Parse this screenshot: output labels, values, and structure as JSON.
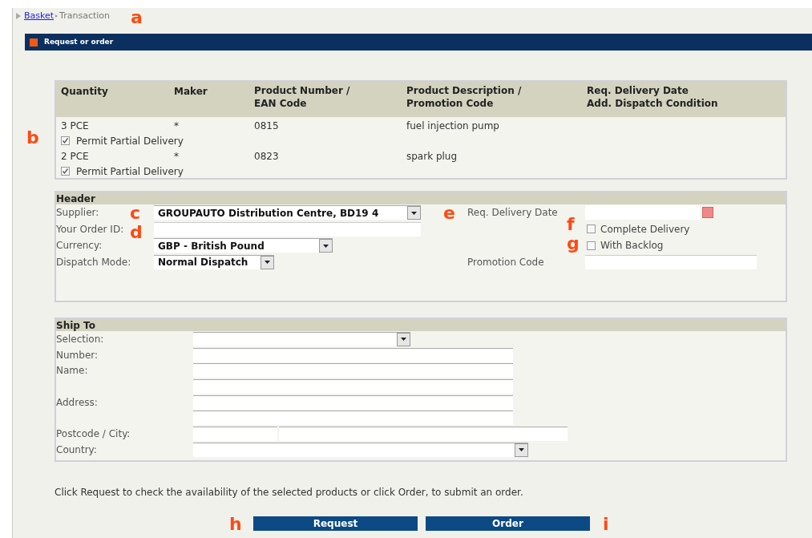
{
  "breadcrumb": [
    {
      "label": "Basket",
      "kind": "link"
    },
    {
      "label": "Transaction",
      "kind": "current"
    }
  ],
  "section_bar": {
    "title": "Request or order"
  },
  "items_table": {
    "columns": [
      "Quantity",
      "Maker",
      "Product Number /\nEAN Code",
      "Product Description /\nPromotion Code",
      "Req. Delivery Date\nAdd. Dispatch Condition"
    ],
    "rows": [
      {
        "quantity": "3",
        "unit": "PCE",
        "maker": "*",
        "product_number": "0815",
        "description": "fuel injection pump",
        "partial_delivery": {
          "label": "Permit Partial Delivery",
          "checked": true
        }
      },
      {
        "quantity": "2",
        "unit": "PCE",
        "maker": "*",
        "product_number": "0823",
        "description": "spark plug",
        "partial_delivery": {
          "label": "Permit Partial Delivery",
          "checked": true
        }
      }
    ]
  },
  "header_panel": {
    "title": "Header",
    "left_fields": [
      {
        "label": "Supplier:",
        "kind": "select",
        "value": "GROUPAUTO Distribution Centre, BD19 4"
      },
      {
        "label": "Your Order ID:",
        "kind": "input"
      },
      {
        "label": "Currency:",
        "kind": "select",
        "value": "GBP - British Pound"
      },
      {
        "label": "Dispatch Mode:",
        "kind": "select",
        "value": "Normal Dispatch"
      }
    ],
    "delivery_date": {
      "label": "Req. Delivery Date"
    },
    "options": [
      {
        "label": "Complete Delivery",
        "checked": false
      },
      {
        "label": "With Backlog",
        "checked": false
      }
    ],
    "promotion_code": {
      "label": "Promotion Code"
    }
  },
  "ship_to": {
    "title": "Ship To",
    "rows": [
      {
        "label": "Selection:",
        "kind": "select"
      },
      {
        "label": "Number:",
        "kind": "input"
      },
      {
        "label": "Name:",
        "kind": "input"
      },
      {
        "kind": "input"
      },
      {
        "label": "Address:",
        "kind": "input"
      },
      {
        "kind": "input"
      },
      {
        "label": "Postcode / City:",
        "kind": "pair"
      },
      {
        "label": "Country:",
        "kind": "select"
      }
    ]
  },
  "hint": "Click Request to check the availability of the selected products or click Order, to submit an order.",
  "buttons": [
    "Request",
    "Order"
  ],
  "annotations": [
    "a",
    "b",
    "c",
    "d",
    "e",
    "f",
    "g",
    "h",
    "i"
  ]
}
